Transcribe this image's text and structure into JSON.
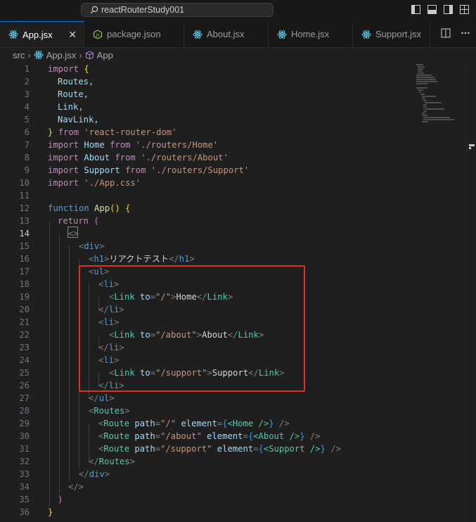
{
  "titlebar": {
    "search_text": "reactRouterStudy001"
  },
  "tabs": [
    {
      "label": "App.jsx",
      "icon": "react-icon",
      "active": true
    },
    {
      "label": "package.json",
      "icon": "nodejs-icon",
      "active": false
    },
    {
      "label": "About.jsx",
      "icon": "react-icon",
      "active": false
    },
    {
      "label": "Home.jsx",
      "icon": "react-icon",
      "active": false
    },
    {
      "label": "Support.jsx",
      "icon": "react-icon",
      "active": false
    }
  ],
  "tab_close": "✕",
  "breadcrumb": {
    "folder": "src",
    "file": "App.jsx",
    "symbol": "App"
  },
  "current_line": 14,
  "code_lines": [
    {
      "n": "1"
    },
    {
      "n": "2"
    },
    {
      "n": "3"
    },
    {
      "n": "4"
    },
    {
      "n": "5"
    },
    {
      "n": "6"
    },
    {
      "n": "7"
    },
    {
      "n": "8"
    },
    {
      "n": "9"
    },
    {
      "n": "10"
    },
    {
      "n": "11"
    },
    {
      "n": "12"
    },
    {
      "n": "13"
    },
    {
      "n": "14"
    },
    {
      "n": "15"
    },
    {
      "n": "16"
    },
    {
      "n": "17"
    },
    {
      "n": "18"
    },
    {
      "n": "19"
    },
    {
      "n": "20"
    },
    {
      "n": "21"
    },
    {
      "n": "22"
    },
    {
      "n": "23"
    },
    {
      "n": "24"
    },
    {
      "n": "25"
    },
    {
      "n": "26"
    },
    {
      "n": "27"
    },
    {
      "n": "28"
    },
    {
      "n": "29"
    },
    {
      "n": "30"
    },
    {
      "n": "31"
    },
    {
      "n": "32"
    },
    {
      "n": "33"
    },
    {
      "n": "34"
    },
    {
      "n": "35"
    },
    {
      "n": "36"
    }
  ],
  "code": {
    "l1": {
      "kw": "import",
      "br": "{"
    },
    "l2": "Routes,",
    "l3": "Route,",
    "l4": "Link,",
    "l5": "NavLink,",
    "l6": {
      "br": "}",
      "kw": "from",
      "str": "'react-router-dom'"
    },
    "l7": {
      "kw": "import",
      "name": "Home",
      "from": "from",
      "str": "'./routers/Home'"
    },
    "l8": {
      "kw": "import",
      "name": "About",
      "from": "from",
      "str": "'./routers/About'"
    },
    "l9": {
      "kw": "import",
      "name": "Support",
      "from": "from",
      "str": "'./routers/Support'"
    },
    "l10": {
      "kw": "import",
      "str": "'./App.css'"
    },
    "l12": {
      "kw": "function",
      "name": "App",
      "parens": "()",
      "br": "{"
    },
    "l13": {
      "kw": "return",
      "paren": "("
    },
    "l14": "<>",
    "l15": {
      "open": "<",
      "tag": "div",
      "close": ">"
    },
    "l16": {
      "o1": "<",
      "t1": "h1",
      "c1": ">",
      "text": "リアクトテスト",
      "o2": "</",
      "t2": "h1",
      "c2": ">"
    },
    "l17": {
      "open": "<",
      "tag": "ul",
      "close": ">"
    },
    "l18": {
      "open": "<",
      "tag": "li",
      "close": ">"
    },
    "l19": {
      "o1": "<",
      "t1": "Link",
      "attr": "to",
      "eq": "=",
      "val": "\"/\"",
      "c1": ">",
      "text": "Home",
      "o2": "</",
      "t2": "Link",
      "c2": ">"
    },
    "l20": {
      "open": "</",
      "tag": "li",
      "close": ">"
    },
    "l21": {
      "open": "<",
      "tag": "li",
      "close": ">"
    },
    "l22": {
      "o1": "<",
      "t1": "Link",
      "attr": "to",
      "eq": "=",
      "val": "\"/about\"",
      "c1": ">",
      "text": "About",
      "o2": "</",
      "t2": "Link",
      "c2": ">"
    },
    "l23": {
      "open": "</",
      "tag": "li",
      "close": ">"
    },
    "l24": {
      "open": "<",
      "tag": "li",
      "close": ">"
    },
    "l25": {
      "o1": "<",
      "t1": "Link",
      "attr": "to",
      "eq": "=",
      "val": "\"/support\"",
      "c1": ">",
      "text": "Support",
      "o2": "</",
      "t2": "Link",
      "c2": ">"
    },
    "l26": {
      "open": "</",
      "tag": "li",
      "close": ">"
    },
    "l27": {
      "open": "</",
      "tag": "ul",
      "close": ">"
    },
    "l28": {
      "open": "<",
      "tag": "Routes",
      "close": ">"
    },
    "l29": {
      "o": "<",
      "t": "Route",
      "a1": "path",
      "v1": "\"/\"",
      "a2": "element",
      "b1": "{",
      "el": "<Home />",
      "b2": "}",
      "c": "/>"
    },
    "l30": {
      "o": "<",
      "t": "Route",
      "a1": "path",
      "v1": "\"/about\"",
      "a2": "element",
      "b1": "{",
      "el": "<About />",
      "b2": "}",
      "c": "/>"
    },
    "l31": {
      "o": "<",
      "t": "Route",
      "a1": "path",
      "v1": "\"/support\"",
      "a2": "element",
      "b1": "{",
      "el": "<Support />",
      "b2": "}",
      "c": "/>"
    },
    "l32": {
      "open": "</",
      "tag": "Routes",
      "close": ">"
    },
    "l33": {
      "open": "</",
      "tag": "div",
      "close": ">"
    },
    "l34": "</>",
    "l35": ")",
    "l36": "}"
  },
  "colors": {
    "highlight_box": "#e0301e",
    "keyword": "#c586c0",
    "string": "#ce9178",
    "component": "#4ec9b0"
  }
}
